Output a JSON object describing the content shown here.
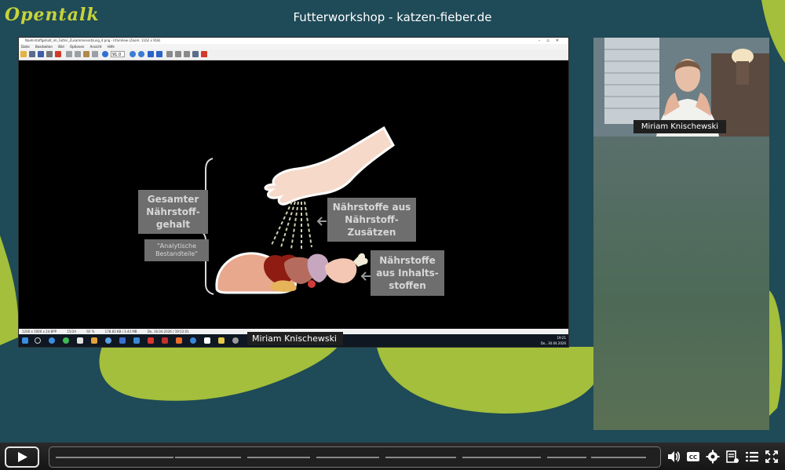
{
  "app": {
    "logo_text": "Opentalk",
    "meeting_title": "Futterworkshop - katzen-fieber.de"
  },
  "shared_window": {
    "title": "Naehrstoffgehalt_im_Futter_Zusammensetzung_4.png - IrfanView (Zoom: 1162 x 918)",
    "menu": [
      "Datei",
      "Bearbeiten",
      "Bild",
      "Optionen",
      "Ansicht",
      "Hilfe"
    ],
    "zoom_value": "91.0",
    "status": [
      "1200 x 1000 x 24 BPP",
      "15/24",
      "92 %",
      "178.83 KB / 3.43 MB",
      "Do, 16.04.2026 / 19:52:01"
    ],
    "clock_time": "19:21",
    "clock_date": "Do., 30.04.2026",
    "presenter_label": "Miriam Knischewski"
  },
  "slide": {
    "total_label": "Gesamter Nährstoff-gehalt",
    "analytic_label": "\"Analytische Bestandteile\"",
    "supplements_label": "Nährstoffe aus Nährstoff-Zusätzen",
    "ingredients_label": "Nährstoffe aus Inhalts-stoffen"
  },
  "participants": [
    {
      "name": "Miriam Knischewski"
    }
  ],
  "player": {
    "icons": [
      "play-icon",
      "volume-icon",
      "cc-icon",
      "settings-icon",
      "chapters-icon",
      "playlist-icon",
      "fullscreen-icon"
    ]
  },
  "colors": {
    "background": "#1f4a57",
    "accent_green": "#a3bf3b",
    "logo": "#c6d43b"
  }
}
